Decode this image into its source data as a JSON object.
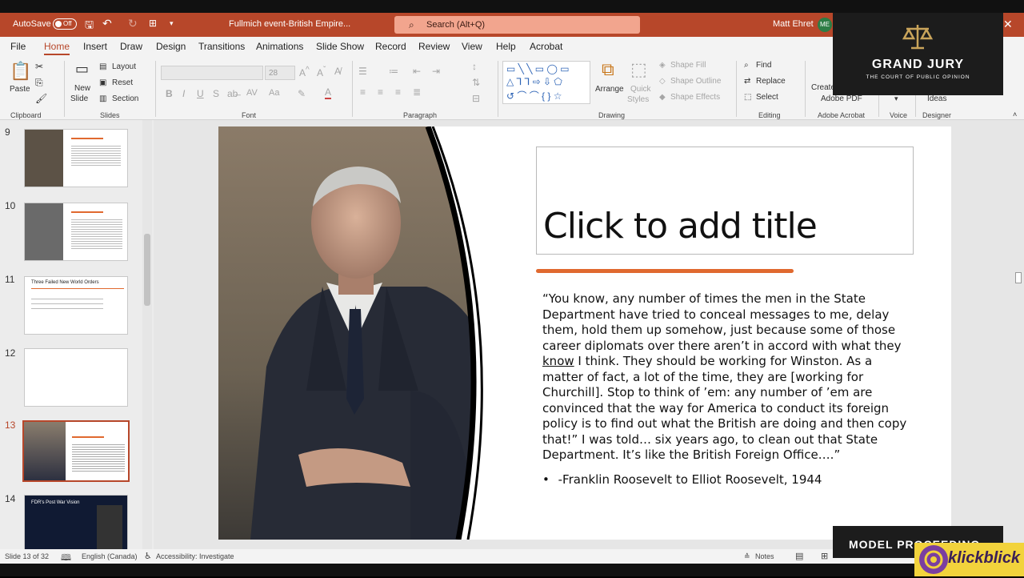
{
  "titlebar": {
    "autosave_label": "AutoSave",
    "autosave_state": "Off",
    "doc_title": "Fullmich event-British Empire...",
    "search_placeholder": "Search (Alt+Q)",
    "user_name": "Matt Ehret",
    "user_initials": "ME",
    "close_glyph": "✕"
  },
  "tabs": [
    "File",
    "Home",
    "Insert",
    "Draw",
    "Design",
    "Transitions",
    "Animations",
    "Slide Show",
    "Record",
    "Review",
    "View",
    "Help",
    "Acrobat"
  ],
  "ribbon": {
    "clipboard": {
      "paste": "Paste",
      "label": "Clipboard"
    },
    "slides": {
      "new_slide_1": "New",
      "new_slide_2": "Slide",
      "layout": "Layout",
      "reset": "Reset",
      "section": "Section",
      "label": "Slides"
    },
    "font": {
      "size": "28",
      "label": "Font"
    },
    "paragraph": {
      "label": "Paragraph"
    },
    "drawing": {
      "arrange": "Arrange",
      "quick_styles_1": "Quick",
      "quick_styles_2": "Styles",
      "shape_fill": "Shape Fill",
      "shape_outline": "Shape Outline",
      "shape_effects": "Shape Effects",
      "label": "Drawing"
    },
    "editing": {
      "find": "Find",
      "replace": "Replace",
      "select": "Select",
      "label": "Editing"
    },
    "acrobat": {
      "create_1": "Create",
      "create_2": "Adobe PDF",
      "label": "Adobe Acrobat"
    },
    "voice": {
      "label": "Voice"
    },
    "designer": {
      "ideas": "Ideas",
      "label": "Designer"
    }
  },
  "slides_panel": {
    "numbers": [
      "9",
      "10",
      "11",
      "12",
      "13",
      "14"
    ],
    "thumb11_title": "Three Failed New World Orders",
    "thumb14_title": "FDR's Post War Vision"
  },
  "slide": {
    "title_placeholder": "Click to add title",
    "quote_part1": "“You know, any number of times the men in the State Department have tried to conceal messages to me, delay them, hold them up somehow, just because some of those career diplomats over there aren’t in accord with what they ",
    "quote_underlined": "know",
    "quote_part2": " I think. They should be working for Winston. As a matter of fact, a lot of the time, they are [working for Churchill]. Stop to think of ’em: any number of ’em are convinced that the way for America to conduct its foreign policy is to find out what the British are doing and then copy that!” I was told… six years ago, to clean out that State Department. It’s like the British Foreign Office….”",
    "bullet_glyph": "•",
    "attribution": "-Franklin Roosevelt to Elliot Roosevelt, 1944"
  },
  "status": {
    "slide_counter": "Slide 13 of 32",
    "language": "English (Canada)",
    "accessibility": "Accessibility: Investigate",
    "notes": "Notes"
  },
  "overlays": {
    "grand_jury_title": "GRAND JURY",
    "grand_jury_subtitle": "THE COURT OF PUBLIC OPINION",
    "model_proceeding": "MODEL PROCEEDING",
    "klickblick": "klickblick"
  },
  "colors": {
    "accent": "#b7472a",
    "orange_bar": "#e0692f",
    "selected_thumb_border": "#b7472a"
  }
}
